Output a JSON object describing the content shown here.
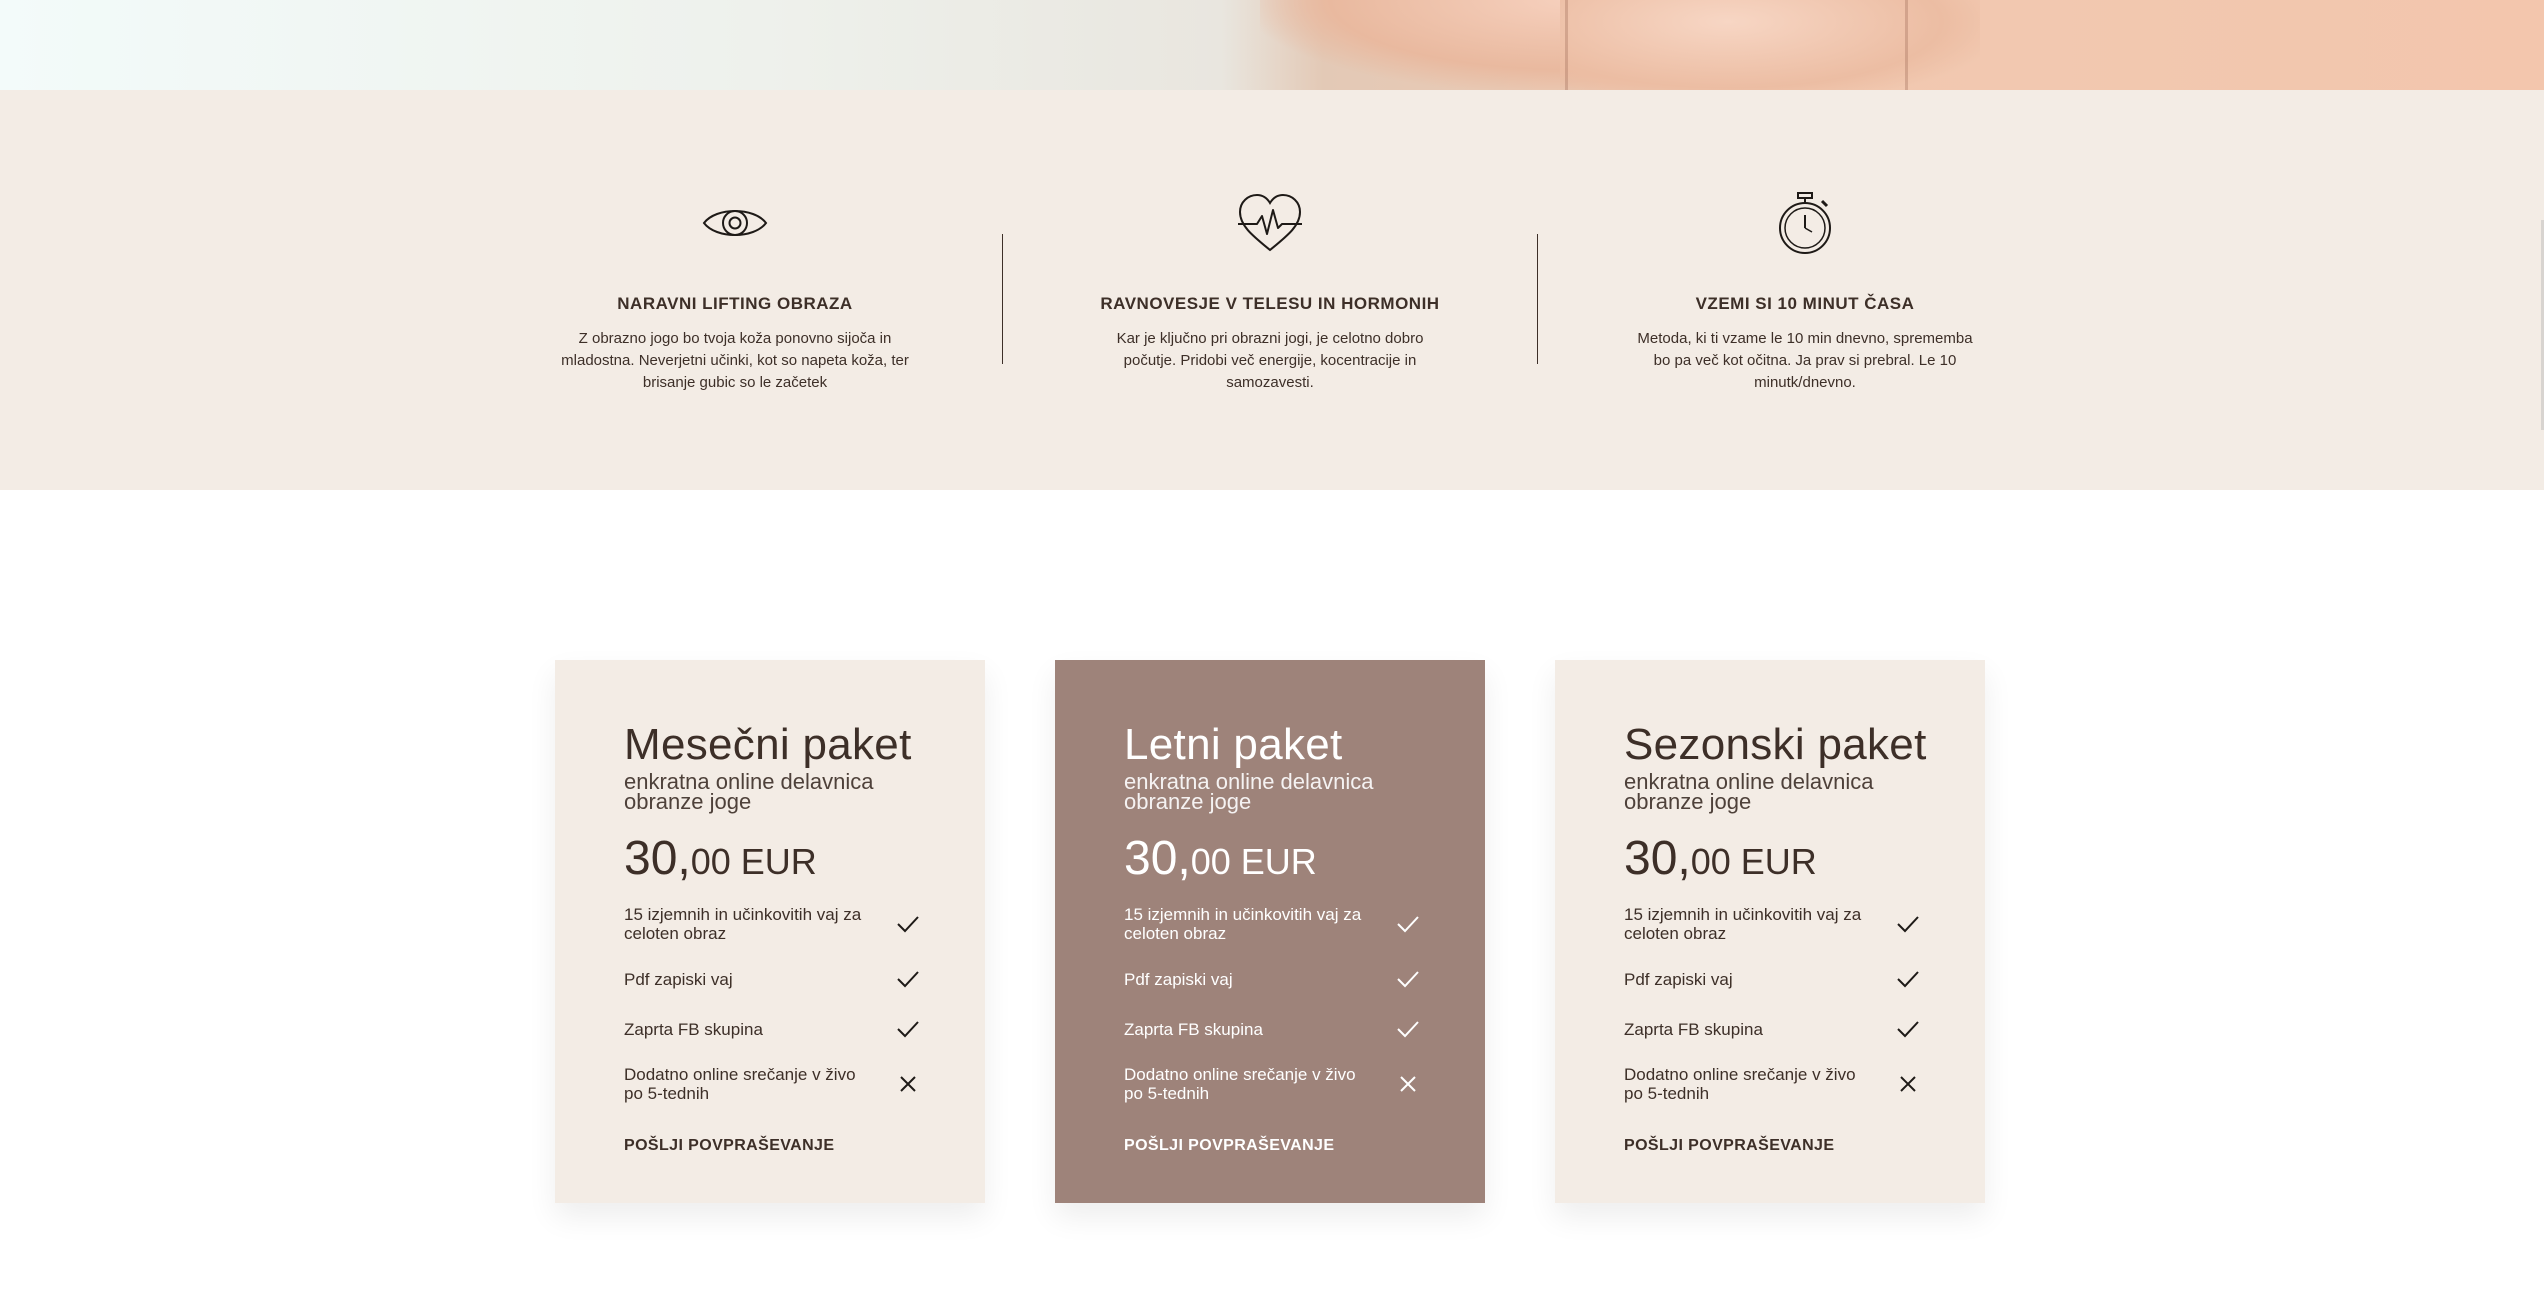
{
  "features": [
    {
      "icon": "eye-icon",
      "title": "NARAVNI LIFTING OBRAZA",
      "text": "Z obrazno jogo bo tvoja koža ponovno sijoča in mladostna. Neverjetni učinki, kot so napeta koža, ter brisanje gubic so le začetek"
    },
    {
      "icon": "heartbeat-icon",
      "title": "RAVNOVESJE V TELESU IN HORMONIH",
      "text": "Kar je ključno pri obrazni jogi, je celotno dobro počutje. Pridobi več energije, kocentracije in samozavesti."
    },
    {
      "icon": "stopwatch-icon",
      "title": "VZEMI SI 10 MINUT ČASA",
      "text": "Metoda, ki ti vzame le 10 min dnevno, sprememba bo pa več kot očitna. Ja prav si prebral. Le 10 minutk/dnevno."
    }
  ],
  "plans": [
    {
      "name": "Mesečni paket",
      "subtitle": "enkratna online delavnica obranze joge",
      "price_main": "30,",
      "price_cents": "00 EUR",
      "items": [
        {
          "text": "15 izjemnih in učinkovitih vaj za celoten obraz",
          "icon": "check-icon"
        },
        {
          "text": "Pdf zapiski vaj",
          "icon": "check-icon"
        },
        {
          "text": "Zaprta FB skupina",
          "icon": "check-icon"
        },
        {
          "text": "Dodatno online srečanje v živo po 5-tednih",
          "icon": "cross-icon"
        }
      ],
      "cta": "POŠLJI POVPRAŠEVANJE"
    },
    {
      "name": "Letni paket",
      "subtitle": "enkratna online delavnica obranze joge",
      "price_main": "30,",
      "price_cents": "00 EUR",
      "items": [
        {
          "text": "15 izjemnih in učinkovitih vaj za celoten obraz",
          "icon": "check-icon"
        },
        {
          "text": "Pdf zapiski vaj",
          "icon": "check-icon"
        },
        {
          "text": "Zaprta FB skupina",
          "icon": "check-icon"
        },
        {
          "text": "Dodatno online srečanje v živo po 5-tednih",
          "icon": "cross-icon"
        }
      ],
      "cta": "POŠLJI POVPRAŠEVANJE"
    },
    {
      "name": "Sezonski paket",
      "subtitle": "enkratna online delavnica obranze joge",
      "price_main": "30,",
      "price_cents": "00 EUR",
      "items": [
        {
          "text": "15 izjemnih in učinkovitih vaj za celoten obraz",
          "icon": "check-icon"
        },
        {
          "text": "Pdf zapiski vaj",
          "icon": "check-icon"
        },
        {
          "text": "Zaprta FB skupina",
          "icon": "check-icon"
        },
        {
          "text": "Dodatno online srečanje v živo po 5-tednih",
          "icon": "cross-icon"
        }
      ],
      "cta": "POŠLJI POVPRAŠEVANJE"
    }
  ],
  "colors": {
    "section_bg": "#f3ece5",
    "featured_card_bg": "#9e837a",
    "text_dark": "#3d2f28"
  }
}
